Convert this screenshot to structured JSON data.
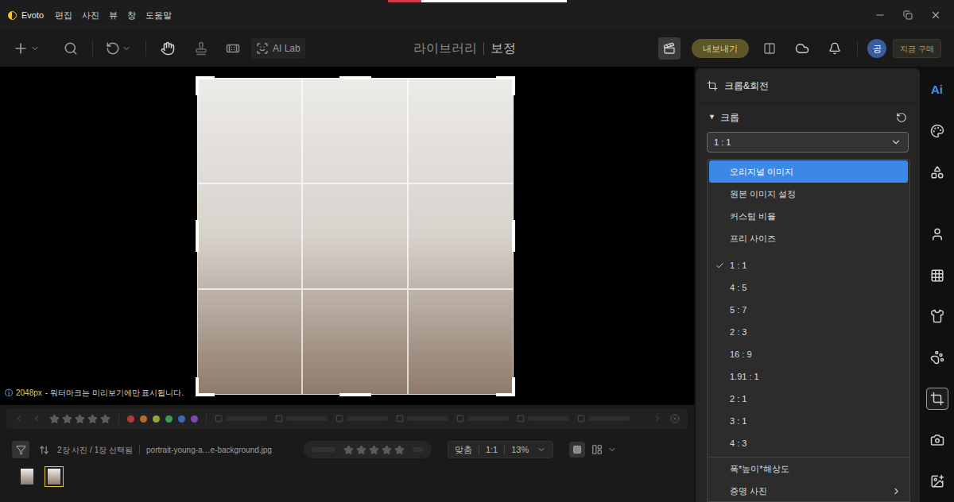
{
  "app": {
    "name": "Evoto",
    "menu": [
      "편집",
      "사진",
      "뷰",
      "창",
      "도움말"
    ]
  },
  "toolbar": {
    "ai_lab": "AI Lab",
    "modes": [
      {
        "label": "라이브러리",
        "selected": false
      },
      {
        "label": "보정",
        "selected": true
      }
    ],
    "export": "내보내기",
    "avatar": "공",
    "buy": "지금 구매"
  },
  "canvas": {
    "note_icon": "ⓘ",
    "note_size": "2048px",
    "note_text": "- 워터마크는 미리보기에만 표시됩니다."
  },
  "panel": {
    "title": "크롭&회전",
    "section": {
      "toggle": "▼",
      "label": "크롭",
      "expanded": true
    },
    "ratio_select": {
      "value": "1 : 1",
      "open": true
    },
    "option_groups": [
      {
        "divider": false,
        "items": [
          {
            "label": "오리지널 이미지",
            "highlighted": true,
            "checked": false,
            "submenu": false
          },
          {
            "label": "원본 이미지 설정",
            "highlighted": false,
            "checked": false,
            "submenu": false
          },
          {
            "label": "커스텀 비율",
            "highlighted": false,
            "checked": false,
            "submenu": false
          },
          {
            "label": "프리 사이즈",
            "highlighted": false,
            "checked": false,
            "submenu": false
          }
        ]
      },
      {
        "divider": false,
        "items": [
          {
            "label": "1 : 1",
            "highlighted": false,
            "checked": true,
            "submenu": false
          },
          {
            "label": "4 : 5",
            "highlighted": false,
            "checked": false,
            "submenu": false
          },
          {
            "label": "5 : 7",
            "highlighted": false,
            "checked": false,
            "submenu": false
          },
          {
            "label": "2 : 3",
            "highlighted": false,
            "checked": false,
            "submenu": false
          },
          {
            "label": "16 : 9",
            "highlighted": false,
            "checked": false,
            "submenu": false
          },
          {
            "label": "1.91 : 1",
            "highlighted": false,
            "checked": false,
            "submenu": false
          },
          {
            "label": "2 : 1",
            "highlighted": false,
            "checked": false,
            "submenu": false
          },
          {
            "label": "3 : 1",
            "highlighted": false,
            "checked": false,
            "submenu": false
          },
          {
            "label": "4 : 3",
            "highlighted": false,
            "checked": false,
            "submenu": false
          }
        ]
      },
      {
        "divider": true,
        "items": [
          {
            "label": "폭*높이*해상도",
            "highlighted": false,
            "checked": false,
            "submenu": false
          },
          {
            "label": "증명 사진",
            "highlighted": false,
            "checked": false,
            "submenu": true
          }
        ]
      }
    ]
  },
  "tool_strip": [
    {
      "label": "Ai",
      "selected": false
    },
    {
      "label": "",
      "selected": false
    },
    {
      "label": "",
      "selected": false
    },
    {
      "label": "",
      "selected": false
    },
    {
      "label": "",
      "selected": false
    },
    {
      "label": "",
      "selected": false
    },
    {
      "label": "",
      "selected": false
    },
    {
      "label": "",
      "selected": true
    },
    {
      "label": "",
      "selected": false
    },
    {
      "label": "",
      "selected": false
    }
  ],
  "filmstrip": {
    "filter_stars": 0,
    "filter_colors": [
      "#b33a3a",
      "#b86a2a",
      "#8fa63a",
      "#3a9a5a",
      "#3a6ab3",
      "#7a4ab3"
    ],
    "count": "2장 사진 / 1장 선택됨",
    "filename": "portrait-young-a…e-background.jpg",
    "rating_stars": 0,
    "fit": "맞춤",
    "ratio": "1:1",
    "zoom": "13%",
    "thumbnails": [
      {
        "selected": false
      },
      {
        "selected": true
      }
    ]
  }
}
